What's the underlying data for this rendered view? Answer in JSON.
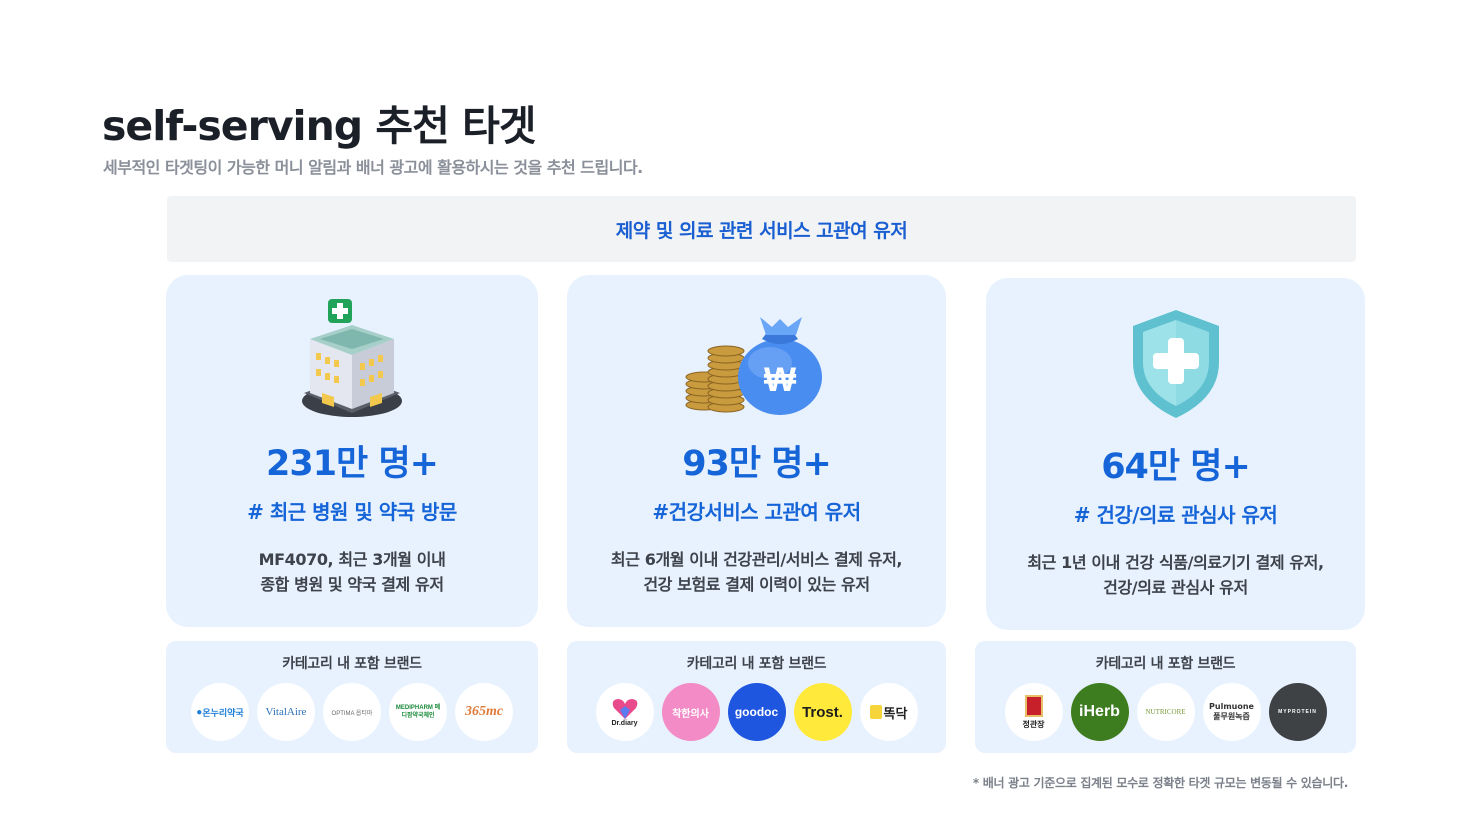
{
  "header": {
    "title": "self-serving 추천 타겟",
    "subtitle": "세부적인 타겟팅이 가능한 머니 알림과 배너 광고에 활용하시는 것을 추천 드립니다."
  },
  "section": {
    "title": "제약 및 의료 관련 서비스 고관여 유저"
  },
  "colors": {
    "accent": "#1665d8",
    "card_bg": "#e8f2fe",
    "bar_bg": "#f2f3f5"
  },
  "cards": [
    {
      "icon": "hospital-building-icon",
      "count": "231만 명+",
      "tag": "# 최근 병원 및 약국 방문",
      "desc_line1": "MF4070, 최근 3개월 이내",
      "desc_line2": "종합 병원 및 약국 결제 유저",
      "brands_title": "카테고리 내 포함 브랜드",
      "brands": [
        "온누리약국",
        "VitalAire",
        "OPTIMA 옵티마",
        "MEDIPHARM 메디팜약국체인",
        "365mc"
      ]
    },
    {
      "icon": "money-bag-icon",
      "count": "93만 명+",
      "tag": "#건강서비스 고관여 유저",
      "desc_line1": "최근 6개월 이내 건강관리/서비스 결제 유저,",
      "desc_line2": "건강 보험료 결제 이력이 있는 유저",
      "brands_title": "카테고리 내 포함 브랜드",
      "brands": [
        "Dr.diary",
        "착한의사",
        "goodoc",
        "Trost.",
        "똑닥"
      ]
    },
    {
      "icon": "medical-shield-icon",
      "count": "64만 명+",
      "tag": "# 건강/의료 관심사 유저",
      "desc_line1": "최근 1년 이내 건강 식품/의료기기 결제 유저,",
      "desc_line2": "건강/의료 관심사 유저",
      "brands_title": "카테고리 내 포함 브랜드",
      "brands": [
        "정관장",
        "iHerb",
        "NUTRICORE",
        "Pulmuone 풀무원녹즙",
        "MYPROTEIN"
      ]
    }
  ],
  "footnote": "* 배너 광고 기준으로 집계된 모수로 정확한 타겟 규모는 변동될 수 있습니다."
}
